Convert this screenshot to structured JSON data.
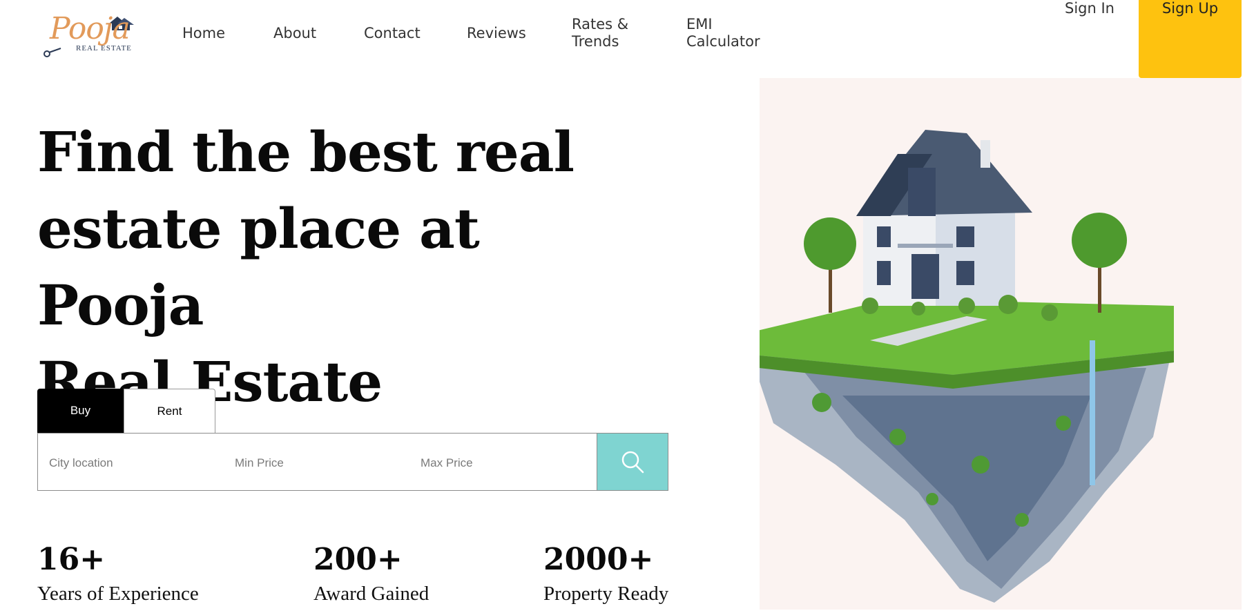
{
  "brand": {
    "script": "Pooja",
    "subtitle": "REAL ESTATE"
  },
  "nav": {
    "items": [
      {
        "label": "Home"
      },
      {
        "label": "About"
      },
      {
        "label": "Contact"
      },
      {
        "label": "Reviews"
      },
      {
        "label": "Rates &",
        "label2": "Trends"
      },
      {
        "label": "EMI",
        "label2": "Calculator"
      }
    ],
    "signin": "Sign In",
    "signup": "Sign Up"
  },
  "hero": {
    "line1": "Find the best real",
    "line2": "estate place at Pooja",
    "line3": "Real Estate"
  },
  "search": {
    "tabs": [
      "Buy",
      "Rent"
    ],
    "active_tab": "Buy",
    "city_placeholder": "City location",
    "min_placeholder": "Min Price",
    "max_placeholder": "Max Price"
  },
  "stats": [
    {
      "value": "16+",
      "label": "Years of Experience"
    },
    {
      "value": "200+",
      "label": "Award Gained"
    },
    {
      "value": "2000+",
      "label": "Property Ready"
    }
  ],
  "colors": {
    "accent": "#fec20f",
    "search_button": "#7fd4d1",
    "illustration_bg": "#fbf3f1"
  },
  "icons": {
    "search": "search-icon",
    "logo": "house-logo-icon"
  }
}
